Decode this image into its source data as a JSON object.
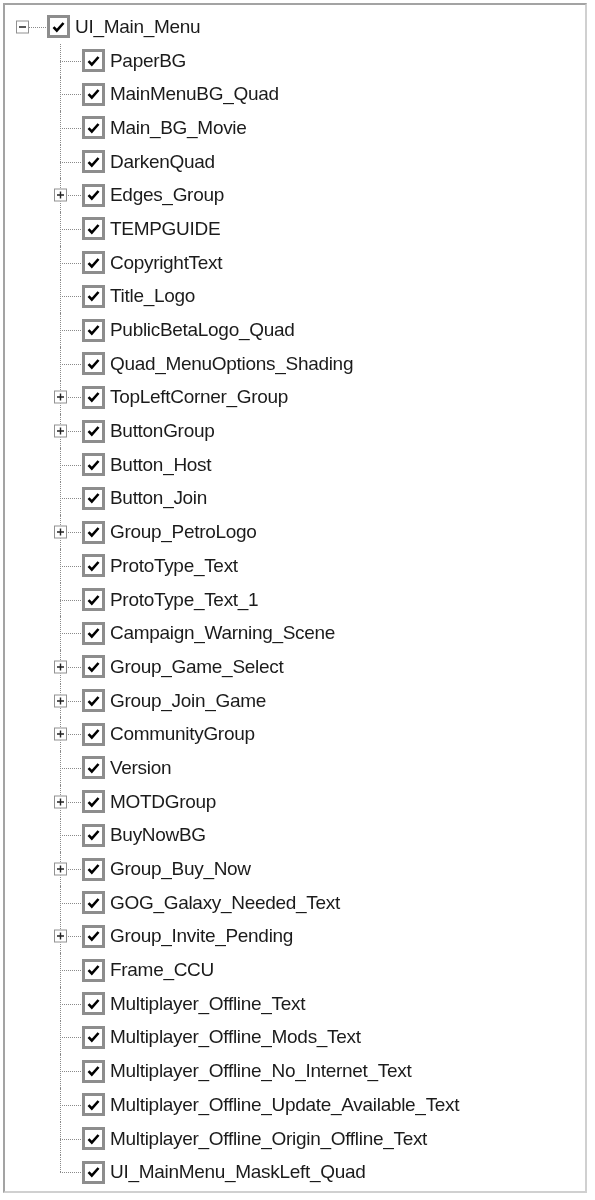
{
  "tree": {
    "label": "UI_Main_Menu",
    "checked": true,
    "expanded": true,
    "children": [
      {
        "label": "PaperBG",
        "checked": true
      },
      {
        "label": "MainMenuBG_Quad",
        "checked": true
      },
      {
        "label": "Main_BG_Movie",
        "checked": true
      },
      {
        "label": "DarkenQuad",
        "checked": true
      },
      {
        "label": "Edges_Group",
        "checked": true,
        "expanded": false
      },
      {
        "label": "TEMPGUIDE",
        "checked": true
      },
      {
        "label": "CopyrightText",
        "checked": true
      },
      {
        "label": "Title_Logo",
        "checked": true
      },
      {
        "label": "PublicBetaLogo_Quad",
        "checked": true
      },
      {
        "label": "Quad_MenuOptions_Shading",
        "checked": true
      },
      {
        "label": "TopLeftCorner_Group",
        "checked": true,
        "expanded": false
      },
      {
        "label": "ButtonGroup",
        "checked": true,
        "expanded": false
      },
      {
        "label": "Button_Host",
        "checked": true
      },
      {
        "label": "Button_Join",
        "checked": true
      },
      {
        "label": "Group_PetroLogo",
        "checked": true,
        "expanded": false
      },
      {
        "label": "ProtoType_Text",
        "checked": true
      },
      {
        "label": "ProtoType_Text_1",
        "checked": true
      },
      {
        "label": "Campaign_Warning_Scene",
        "checked": true
      },
      {
        "label": "Group_Game_Select",
        "checked": true,
        "expanded": false
      },
      {
        "label": "Group_Join_Game",
        "checked": true,
        "expanded": false
      },
      {
        "label": "CommunityGroup",
        "checked": true,
        "expanded": false
      },
      {
        "label": "Version",
        "checked": true
      },
      {
        "label": "MOTDGroup",
        "checked": true,
        "expanded": false
      },
      {
        "label": "BuyNowBG",
        "checked": true
      },
      {
        "label": "Group_Buy_Now",
        "checked": true,
        "expanded": false
      },
      {
        "label": "GOG_Galaxy_Needed_Text",
        "checked": true
      },
      {
        "label": "Group_Invite_Pending",
        "checked": true,
        "expanded": false
      },
      {
        "label": "Frame_CCU",
        "checked": true
      },
      {
        "label": "Multiplayer_Offline_Text",
        "checked": true
      },
      {
        "label": "Multiplayer_Offline_Mods_Text",
        "checked": true
      },
      {
        "label": "Multiplayer_Offline_No_Internet_Text",
        "checked": true
      },
      {
        "label": "Multiplayer_Offline_Update_Available_Text",
        "checked": true
      },
      {
        "label": "Multiplayer_Offline_Origin_Offline_Text",
        "checked": true
      },
      {
        "label": "UI_MainMenu_MaskLeft_Quad",
        "checked": true
      }
    ]
  }
}
